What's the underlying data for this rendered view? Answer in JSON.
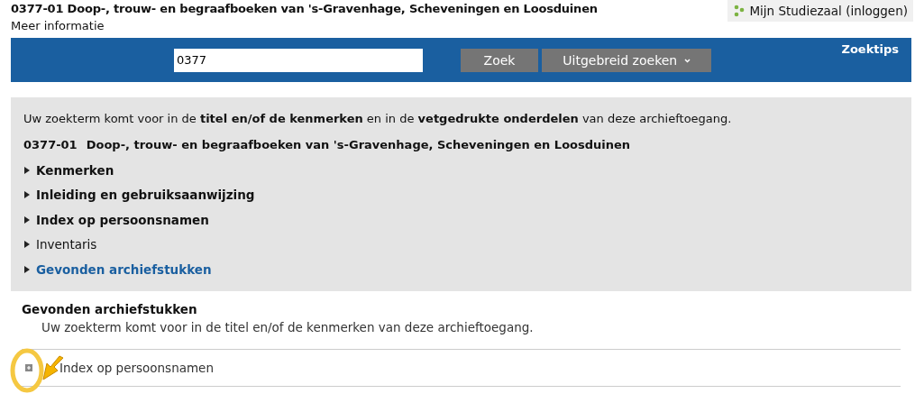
{
  "header": {
    "title": "0377-01 Doop-, trouw- en begraafboeken van 's-Gravenhage, Scheveningen en Loosduinen",
    "more_info": "Meer informatie",
    "login": "Mijn Studiezaal (inloggen)"
  },
  "search": {
    "value": "0377",
    "button": "Zoek",
    "advanced": "Uitgebreid zoeken",
    "tips": "Zoektips"
  },
  "result": {
    "intro": "Uw zoekterm komt voor in de **titel en/of de kenmerken** en in de **vetgedrukte onderdelen** van deze archieftoegang.",
    "code": "0377-01",
    "title": "Doop-, trouw- en begraafboeken van 's-Gravenhage, Scheveningen en Loosduinen",
    "items": [
      {
        "label": "Kenmerken",
        "kind": "bold",
        "expanded": false
      },
      {
        "label": "Inleiding en gebruiksaanwijzing",
        "kind": "bold",
        "expanded": false
      },
      {
        "label": "Index op persoonsnamen",
        "kind": "bold",
        "expanded": false
      },
      {
        "label": "Inventaris",
        "kind": "plain",
        "expanded": false
      },
      {
        "label": "Gevonden archiefstukken",
        "kind": "link",
        "expanded": false
      }
    ]
  },
  "found": {
    "heading": "Gevonden archiefstukken",
    "note": "Uw zoekterm komt voor in de titel en/of de kenmerken van deze archieftoegang.",
    "rows": [
      {
        "label": "Index op persoonsnamen",
        "expanded": false
      }
    ]
  }
}
